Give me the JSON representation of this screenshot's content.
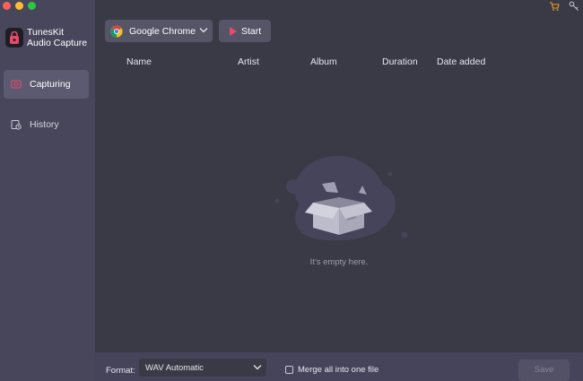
{
  "app": {
    "name_line1": "TunesKit",
    "name_line2": "Audio Capture"
  },
  "sidebar": {
    "items": [
      {
        "label": "Capturing",
        "active": true,
        "icon": "capture-icon"
      },
      {
        "label": "History",
        "active": false,
        "icon": "history-icon"
      }
    ]
  },
  "toolbar": {
    "source_label": "Google Chrome",
    "start_label": "Start"
  },
  "table": {
    "columns": [
      "Name",
      "Artist",
      "Album",
      "Duration",
      "Date added"
    ]
  },
  "empty_state": {
    "message": "It's empty here."
  },
  "bottom": {
    "format_label": "Format:",
    "format_value": "WAV Automatic",
    "merge_label": "Merge all into one file",
    "merge_checked": false,
    "save_label": "Save"
  },
  "colors": {
    "accent": "#e84a6a",
    "cart": "#f0a020"
  }
}
